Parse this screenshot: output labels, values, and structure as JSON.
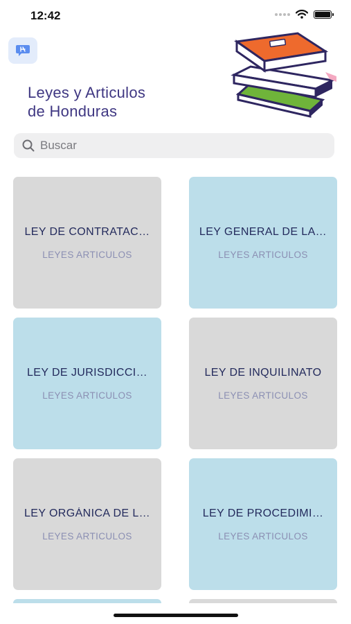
{
  "status_bar": {
    "time": "12:42"
  },
  "header": {
    "chat_icon": "chat-bubble-icon",
    "title_line1": "Leyes y Articulos",
    "title_line2": "de Honduras",
    "illustration": "book-stack-illustration"
  },
  "search": {
    "placeholder": "Buscar",
    "value": ""
  },
  "colors": {
    "card_gray": "#d9d9d9",
    "card_blue": "#bcdeea",
    "title": "#3f3782",
    "card_text": "#232a5c"
  },
  "cards": [
    {
      "title": "LEY DE CONTRATAC…",
      "subtitle": "LEYES ARTICULOS",
      "color": "gray"
    },
    {
      "title": "LEY GENERAL DE LA…",
      "subtitle": "LEYES ARTICULOS",
      "color": "blue"
    },
    {
      "title": "LEY DE JURISDICCI…",
      "subtitle": "LEYES ARTICULOS",
      "color": "blue"
    },
    {
      "title": "LEY DE INQUILINATO",
      "subtitle": "LEYES ARTICULOS",
      "color": "gray"
    },
    {
      "title": "LEY ORGÁNICA DE L…",
      "subtitle": "LEYES ARTICULOS",
      "color": "gray"
    },
    {
      "title": "LEY DE PROCEDIMI…",
      "subtitle": "LEYES ARTICULOS",
      "color": "blue"
    }
  ]
}
